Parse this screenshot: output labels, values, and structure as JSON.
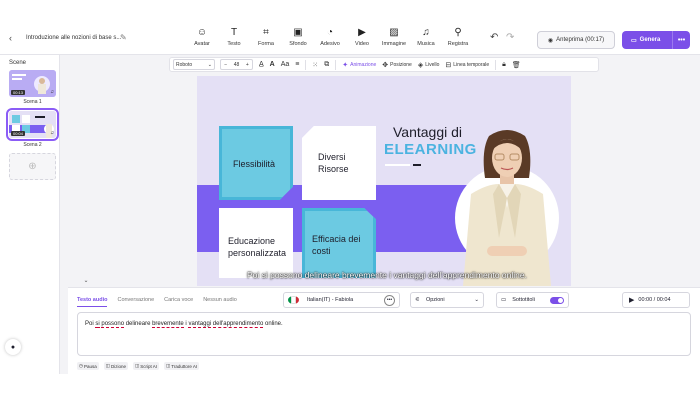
{
  "header": {
    "back_icon": "chevron-left-icon",
    "doc_title": "Introduzione alle nozioni di base s...",
    "tools": [
      {
        "label": "Avatar",
        "icon": "avatar-icon",
        "glyph": "☺"
      },
      {
        "label": "Testo",
        "icon": "text-icon",
        "glyph": "T"
      },
      {
        "label": "Forma",
        "icon": "shapes-icon",
        "glyph": "⌗"
      },
      {
        "label": "Sfondo",
        "icon": "background-icon",
        "glyph": "▣"
      },
      {
        "label": "Adesivo",
        "icon": "sticker-icon",
        "glyph": "◔"
      },
      {
        "label": "Video",
        "icon": "video-icon",
        "glyph": "▶"
      },
      {
        "label": "Immagine",
        "icon": "image-icon",
        "glyph": "▨"
      },
      {
        "label": "Musica",
        "icon": "music-icon",
        "glyph": "♫"
      },
      {
        "label": "Registra",
        "icon": "record-icon",
        "glyph": "⚲"
      }
    ],
    "preview_label": "Anteprima (00:17)",
    "generate_label": "Genera"
  },
  "scenes": {
    "title": "Scene",
    "items": [
      {
        "label": "Scena 1",
        "duration": "00:13"
      },
      {
        "label": "Scena 2",
        "duration": "00:04"
      }
    ]
  },
  "format_toolbar": {
    "font": "Roboto",
    "size": "48",
    "animation_label": "Animazione",
    "position_label": "Posizione",
    "level_label": "Livello",
    "timeline_label": "Linea temporale"
  },
  "canvas": {
    "title_line1": "Vantaggi di",
    "title_line2": "ELEARNING",
    "box1": "Flessibilità",
    "box2": "Diversi Risorse",
    "box3": "Educazione personalizzata",
    "box4": "Efficacia dei costi",
    "subtitle": "Poi si possono delineare brevemente i vantaggi dell'apprendimento online."
  },
  "bottom": {
    "tabs": [
      "Testo audio",
      "Conversazione",
      "Carica voce",
      "Nessun audio"
    ],
    "active_tab": "Testo audio",
    "voice": "Italian(IT) - Fabiola",
    "options_label": "Opzioni",
    "subtitles_label": "Sottotitoli",
    "time": "00:00 / 00:04",
    "script_text": "Poi si possono delineare brevemente i vantaggi dell'apprendimento online.",
    "chips": [
      "Pausa",
      "Dizione",
      "Script AI",
      "Traduttore AI"
    ]
  },
  "colors": {
    "accent": "#7b4fe8",
    "elearning": "#4bb3e0",
    "box_blue": "#6ccae2"
  }
}
